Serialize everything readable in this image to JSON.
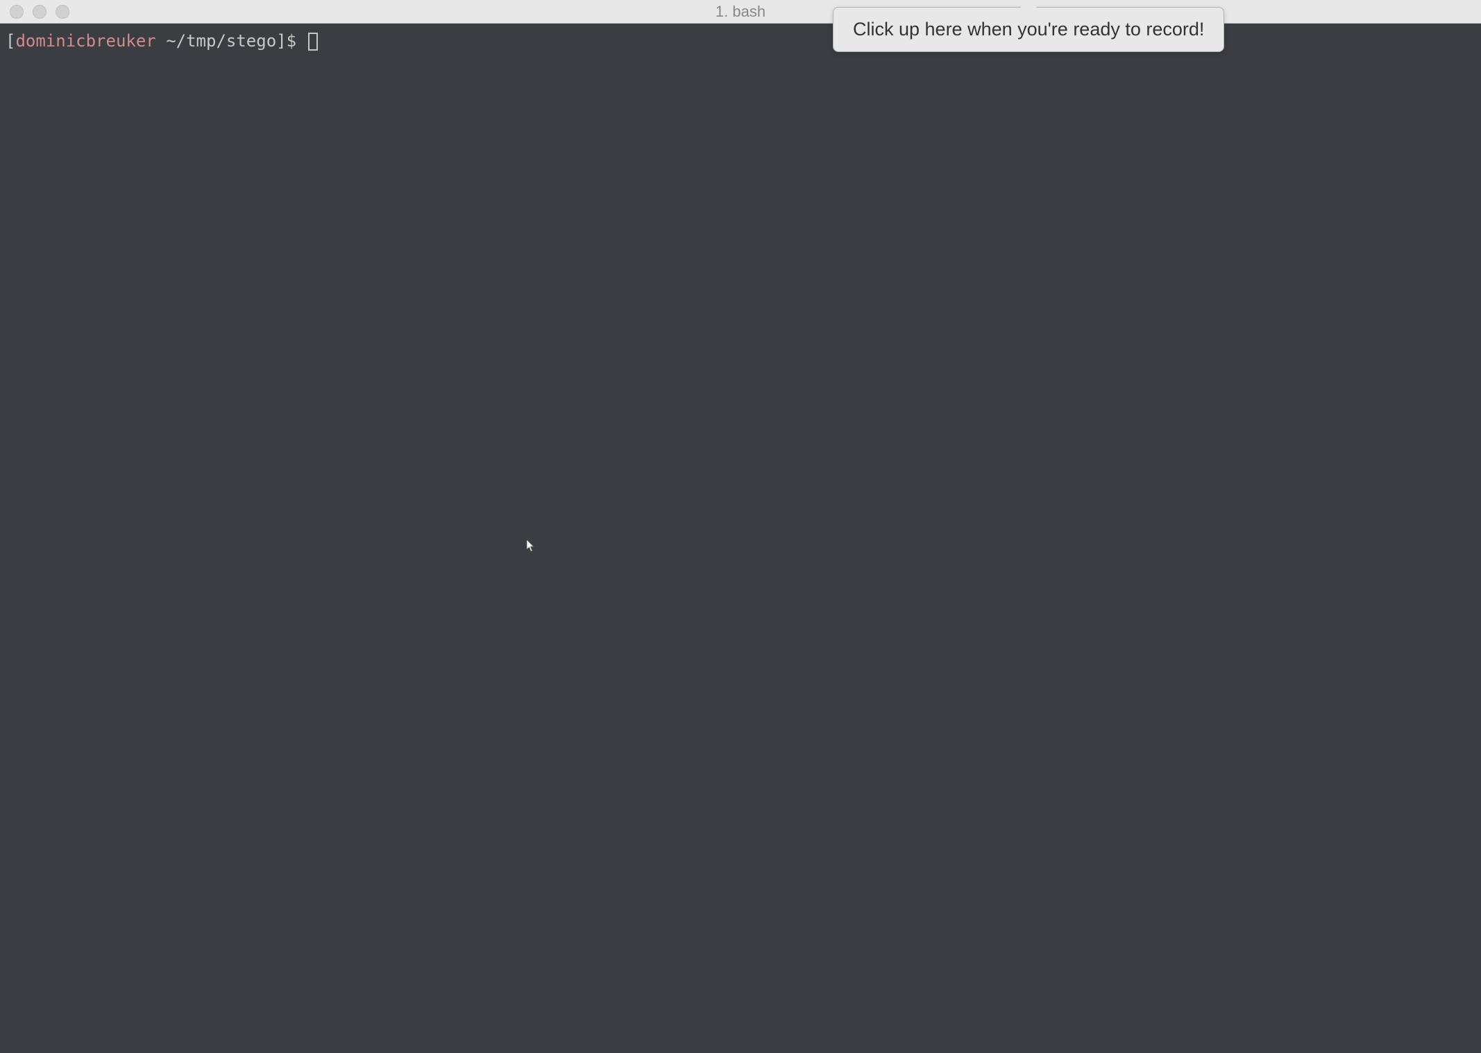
{
  "titlebar": {
    "title": "1. bash"
  },
  "prompt": {
    "bracket_open": "[",
    "username": "dominicbreuker",
    "separator": " ",
    "path": "~/tmp/stego",
    "bracket_close": "]",
    "symbol": "$ "
  },
  "tooltip": {
    "text": "Click up here when you're ready to record!"
  }
}
